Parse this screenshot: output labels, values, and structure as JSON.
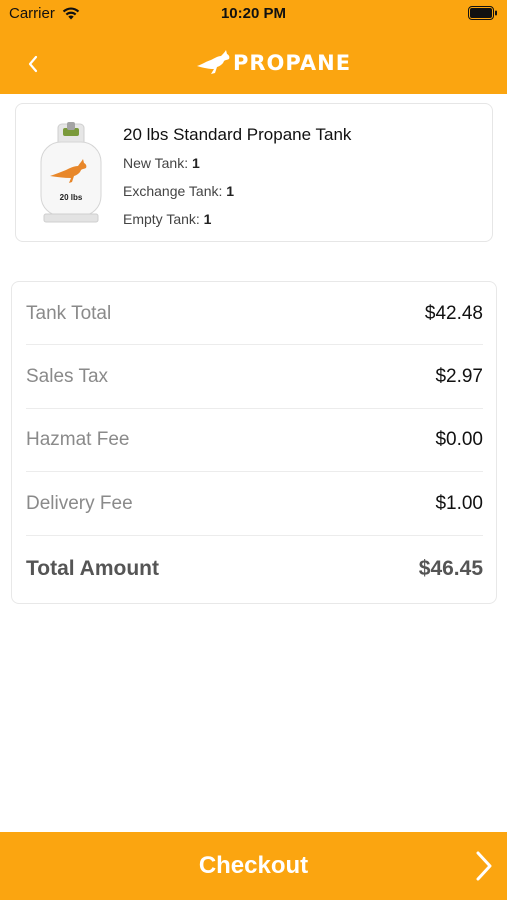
{
  "status_bar": {
    "carrier": "Carrier",
    "time": "10:20 PM"
  },
  "header": {
    "logo_text": "PROPANE"
  },
  "product": {
    "title": "20 lbs Standard Propane Tank",
    "tank_label": "20 lbs",
    "new_tank_label": "New Tank:",
    "new_tank_value": "1",
    "exchange_tank_label": "Exchange Tank:",
    "exchange_tank_value": "1",
    "empty_tank_label": "Empty Tank:",
    "empty_tank_value": "1"
  },
  "summary": {
    "rows": [
      {
        "label": "Tank Total",
        "value": "$42.48"
      },
      {
        "label": "Sales Tax",
        "value": "$2.97"
      },
      {
        "label": "Hazmat Fee",
        "value": "$0.00"
      },
      {
        "label": "Delivery Fee",
        "value": "$1.00"
      }
    ],
    "total_label": "Total Amount",
    "total_value": "$46.45"
  },
  "checkout": {
    "label": "Checkout"
  },
  "colors": {
    "accent": "#fba510",
    "kangaroo": "#e8872a"
  }
}
